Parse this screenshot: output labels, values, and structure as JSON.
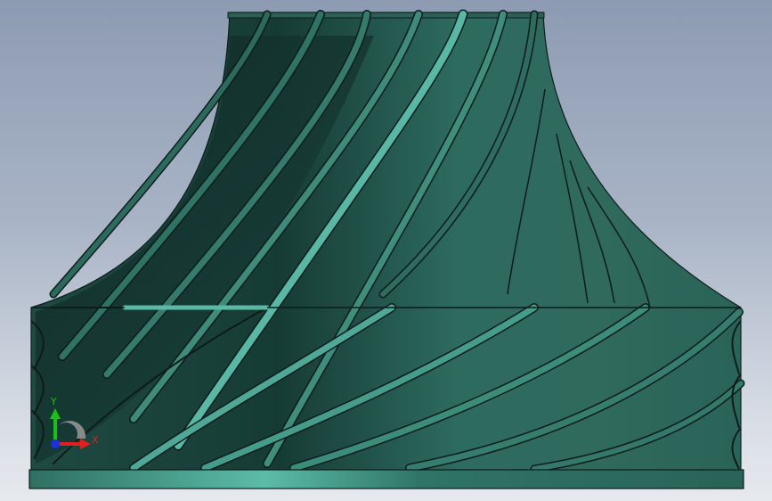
{
  "viewport": {
    "background_top": "#8d9bb2",
    "background_bottom": "#e6e9ee",
    "part_color": "#2f6b5e",
    "highlight_color": "#57b3a2",
    "edge_color": "#0d1c19"
  },
  "triad": {
    "x_label": "X",
    "y_label": "Y",
    "x_color": "#e02020",
    "y_color": "#18c018",
    "z_color": "#1830e0"
  }
}
